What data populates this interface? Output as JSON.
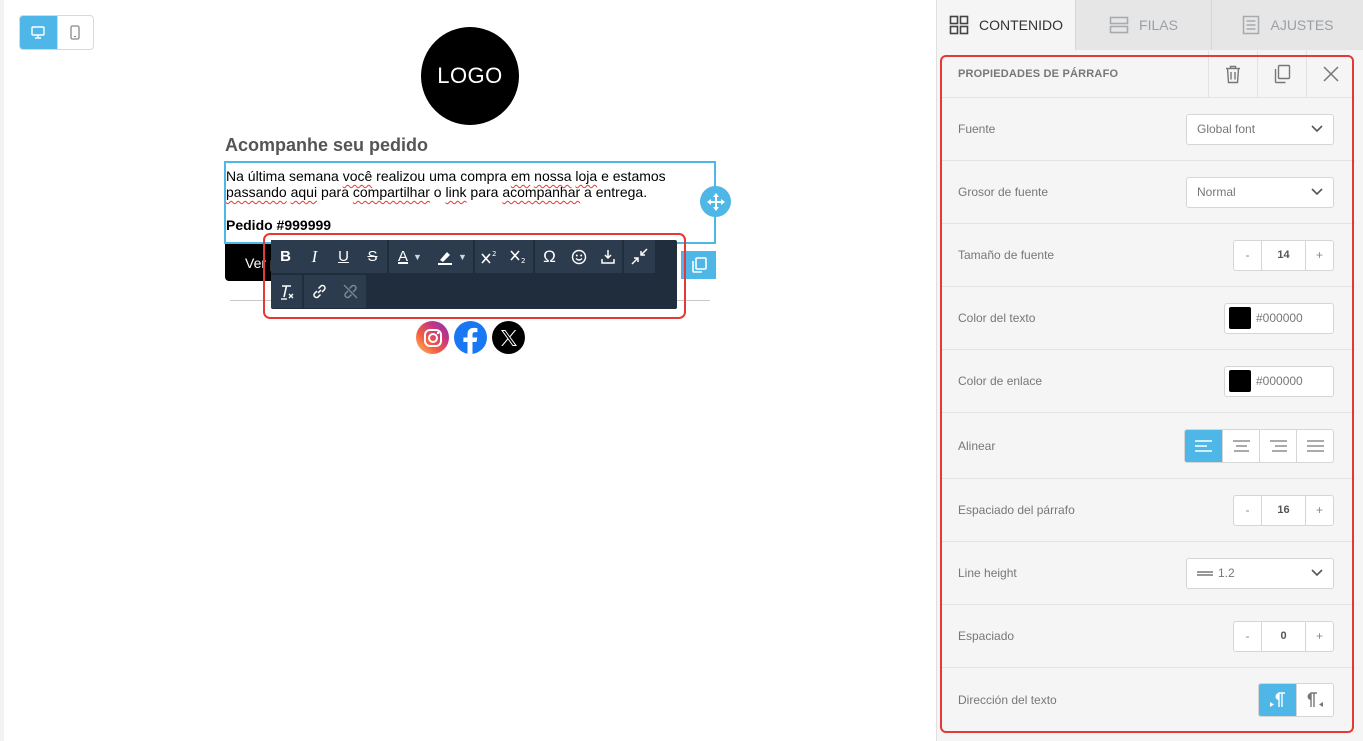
{
  "canvas": {
    "logo_text": "LOGO",
    "heading": "Acompanhe seu pedido",
    "paragraph": {
      "line1": [
        "Na última semana ",
        "você",
        " realizou uma compra ",
        "em",
        " ",
        "nossa",
        " ",
        "loja",
        " e estamos"
      ],
      "line2": [
        "passando",
        " ",
        "aqui",
        " para ",
        "compartilhar",
        " o ",
        "link",
        " para ",
        "acompanhar",
        " a entrega."
      ],
      "order": "Pedido #999999"
    },
    "button_label": "Ver pedido",
    "social": [
      "instagram-icon",
      "facebook-icon",
      "x-icon"
    ]
  },
  "toolbar": {
    "bold": "B",
    "italic": "I",
    "underline": "U",
    "strike": "S",
    "text_color": "A",
    "special_char": "Ω"
  },
  "sidebar": {
    "tabs": {
      "contenido": "CONTENIDO",
      "filas": "FILAS",
      "ajustes": "AJUSTES"
    },
    "panel_title": "PROPIEDADES DE PÁRRAFO",
    "fuente": {
      "label": "Fuente",
      "value": "Global font"
    },
    "grosor": {
      "label": "Grosor de fuente",
      "value": "Normal"
    },
    "tamano": {
      "label": "Tamaño de fuente",
      "value": "14",
      "minus": "-",
      "plus": "+"
    },
    "color_texto": {
      "label": "Color del texto",
      "value": "#000000",
      "swatch": "#000000"
    },
    "color_enlace": {
      "label": "Color de enlace",
      "value": "#000000",
      "swatch": "#000000"
    },
    "alinear": {
      "label": "Alinear",
      "selected": "left"
    },
    "espaciado_parrafo": {
      "label": "Espaciado del párrafo",
      "value": "16",
      "minus": "-",
      "plus": "+"
    },
    "line_height": {
      "label": "Line height",
      "value": "1.2"
    },
    "espaciado": {
      "label": "Espaciado",
      "value": "0",
      "minus": "-",
      "plus": "+"
    },
    "direccion": {
      "label": "Dirección del texto",
      "selected": "ltr"
    }
  },
  "colors": {
    "accent": "#4fb7e8",
    "highlight": "#e53935",
    "toolbar_bg": "#1f2d3d"
  }
}
